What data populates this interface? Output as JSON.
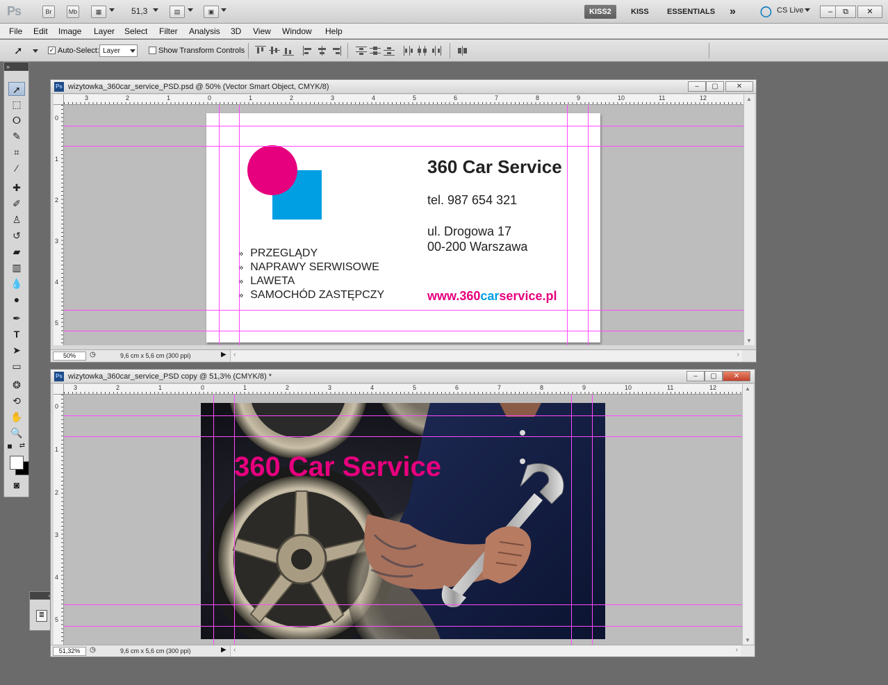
{
  "app": {
    "logo": "Ps",
    "bridge_btn": "Br",
    "minibridge_btn": "Mb",
    "zoom_value": "51,3",
    "workspaces": [
      "KISS2",
      "KISS",
      "ESSENTIALS"
    ],
    "workspace_more": "»",
    "cs_live": "CS Live",
    "win_minimize": "–",
    "win_restore": "⧉",
    "win_close": "✕"
  },
  "menu": [
    "File",
    "Edit",
    "Image",
    "Layer",
    "Select",
    "Filter",
    "Analysis",
    "3D",
    "View",
    "Window",
    "Help"
  ],
  "options": {
    "auto_select_label": "Auto-Select:",
    "auto_select_value": "Layer",
    "show_transform_label": "Show Transform Controls"
  },
  "tools": {
    "collapse": "»"
  },
  "doc1": {
    "title": "wizytowka_360car_service_PSD.psd @ 50% (Vector Smart Object, CMYK/8)",
    "zoom": "50%",
    "info": "9,6 cm x 5,6 cm (300 ppi)",
    "ruler_h": [
      "3",
      "2",
      "1",
      "0",
      "1",
      "2",
      "3",
      "4",
      "5",
      "6",
      "7",
      "8",
      "9",
      "10",
      "11",
      "12"
    ],
    "ruler_v": [
      "0",
      "1",
      "2",
      "3",
      "4",
      "5"
    ],
    "card": {
      "title": "360 Car Service",
      "tel": "tel. 987 654 321",
      "street": "ul. Drogowa 17",
      "city": "00-200 Warszawa",
      "bullet": "»",
      "services": [
        "PRZEGLĄDY",
        "NAPRAWY SERWISOWE",
        "LAWETA",
        "SAMOCHÓD ZASTĘPCZY"
      ],
      "url_prefix": "www.360",
      "url_mid": "car",
      "url_suffix": "service.pl"
    }
  },
  "doc2": {
    "title": "wizytowka_360car_service_PSD copy @ 51,3% (CMYK/8) *",
    "zoom": "51,32%",
    "info": "9,6 cm x 5,6 cm (300 ppi)",
    "ruler_h": [
      "3",
      "2",
      "1",
      "0",
      "1",
      "2",
      "3",
      "4",
      "5",
      "6",
      "7",
      "8",
      "9",
      "10",
      "11",
      "12"
    ],
    "ruler_v": [
      "0",
      "1",
      "2",
      "3",
      "4",
      "5"
    ],
    "photo_title": "360 Car Service"
  },
  "colors": {
    "brand_magenta": "#e6007e",
    "brand_cyan": "#009fe3",
    "guide": "#ff48ff"
  }
}
